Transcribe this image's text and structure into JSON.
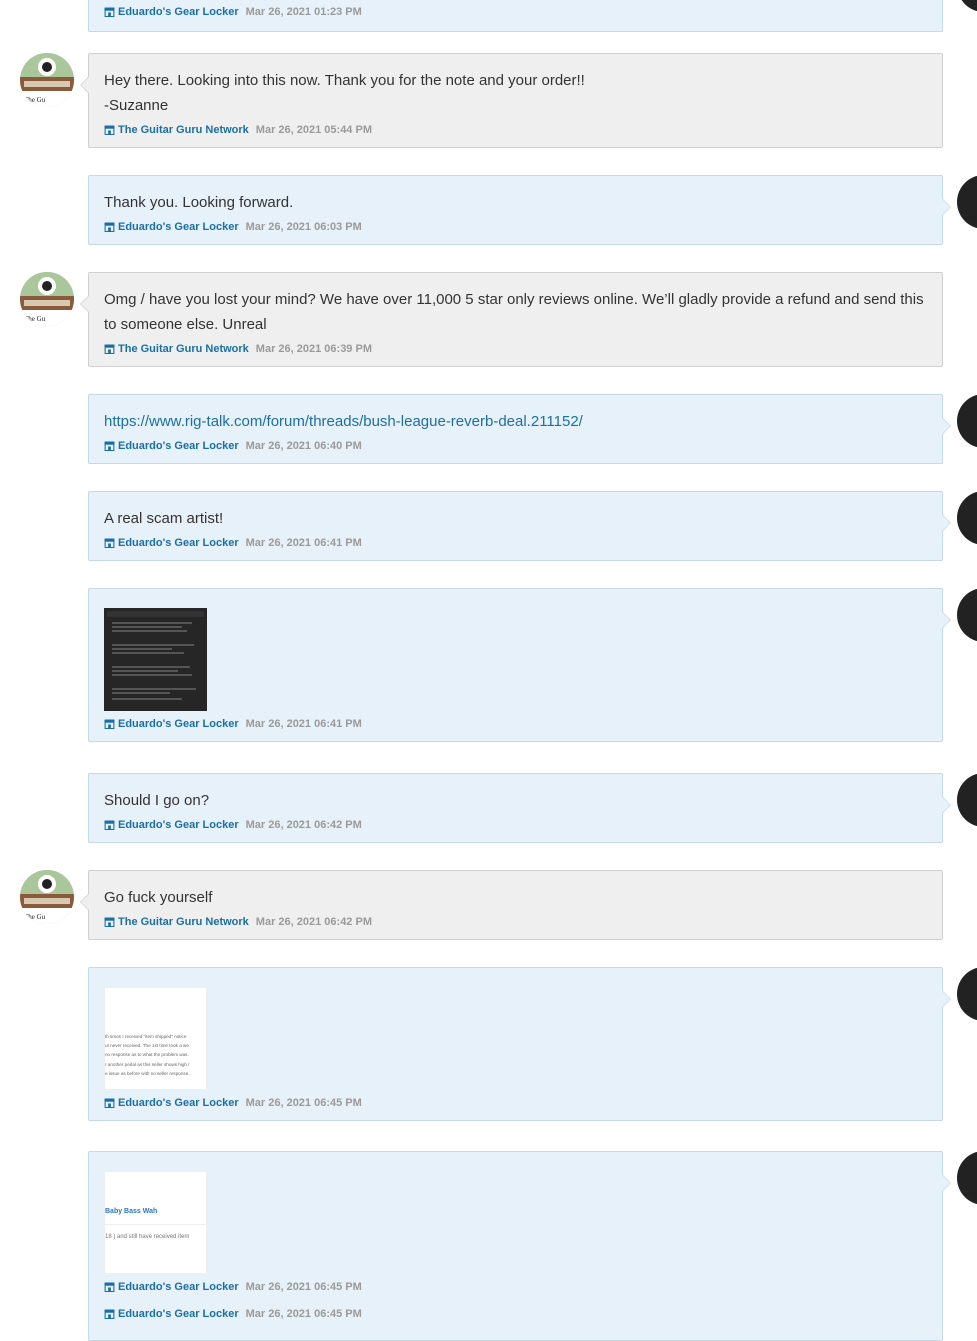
{
  "messages": [
    {
      "side": "buyer",
      "text": "",
      "sender": "Eduardo's Gear Locker",
      "time": "Mar 26, 2021 01:23 PM"
    },
    {
      "side": "seller",
      "text": "Hey there. Looking into this now. Thank you for the note and your order!!\n-Suzanne",
      "sender": "The Guitar Guru Network",
      "time": "Mar 26, 2021 05:44 PM"
    },
    {
      "side": "buyer",
      "text": "Thank you. Looking forward.",
      "sender": "Eduardo's Gear Locker",
      "time": "Mar 26, 2021 06:03 PM"
    },
    {
      "side": "seller",
      "text": "Omg / have you lost your mind? We have over 11,000 5 star only reviews online. We’ll gladly provide a refund and send this to someone else. Unreal",
      "sender": "The Guitar Guru Network",
      "time": "Mar 26, 2021 06:39 PM"
    },
    {
      "side": "buyer",
      "link": "https://www.rig-talk.com/forum/threads/bush-league-reverb-deal.211152/",
      "sender": "Eduardo's Gear Locker",
      "time": "Mar 26, 2021 06:40 PM"
    },
    {
      "side": "buyer",
      "text": "A real scam artist!",
      "sender": "Eduardo's Gear Locker",
      "time": "Mar 26, 2021 06:41 PM"
    },
    {
      "side": "buyer",
      "attachment": "dark-screenshot",
      "sender": "Eduardo's Gear Locker",
      "time": "Mar 26, 2021 06:41 PM"
    },
    {
      "side": "buyer",
      "text": "Should I go on?",
      "sender": "Eduardo's Gear Locker",
      "time": "Mar 26, 2021 06:42 PM"
    },
    {
      "side": "seller",
      "text": "Go fuck yourself",
      "sender": "The Guitar Guru Network",
      "time": "Mar 26, 2021 06:42 PM"
    },
    {
      "side": "buyer",
      "attachment": "review-screenshot",
      "sender": "Eduardo's Gear Locker",
      "time": "Mar 26, 2021 06:45 PM"
    },
    {
      "side": "buyer",
      "attachment": "wah-screenshot",
      "sender": "Eduardo's Gear Locker",
      "time": "Mar 26, 2021 06:45 PM"
    },
    {
      "side": "buyer",
      "text": "",
      "sender": "Eduardo's Gear Locker",
      "time": "Mar 26, 2021 06:45 PM"
    }
  ],
  "attachments": {
    "review_text": [
      "th times I received \"item shipped\" notice",
      "ut never received. The 1st time took a we",
      "no response as to what the problem was.",
      "r another pedal as this seller shows high r",
      "e issue as before with no seller response."
    ],
    "wah_title": "Baby Bass Wah",
    "wah_text": "18 ) and still have received item"
  },
  "colors": {
    "buyer_bg": "#e7f1f9",
    "seller_bg": "#efefef",
    "link": "#1a6fa8",
    "time": "#9a9a9a"
  },
  "icons": {
    "shop": "shop-icon"
  }
}
